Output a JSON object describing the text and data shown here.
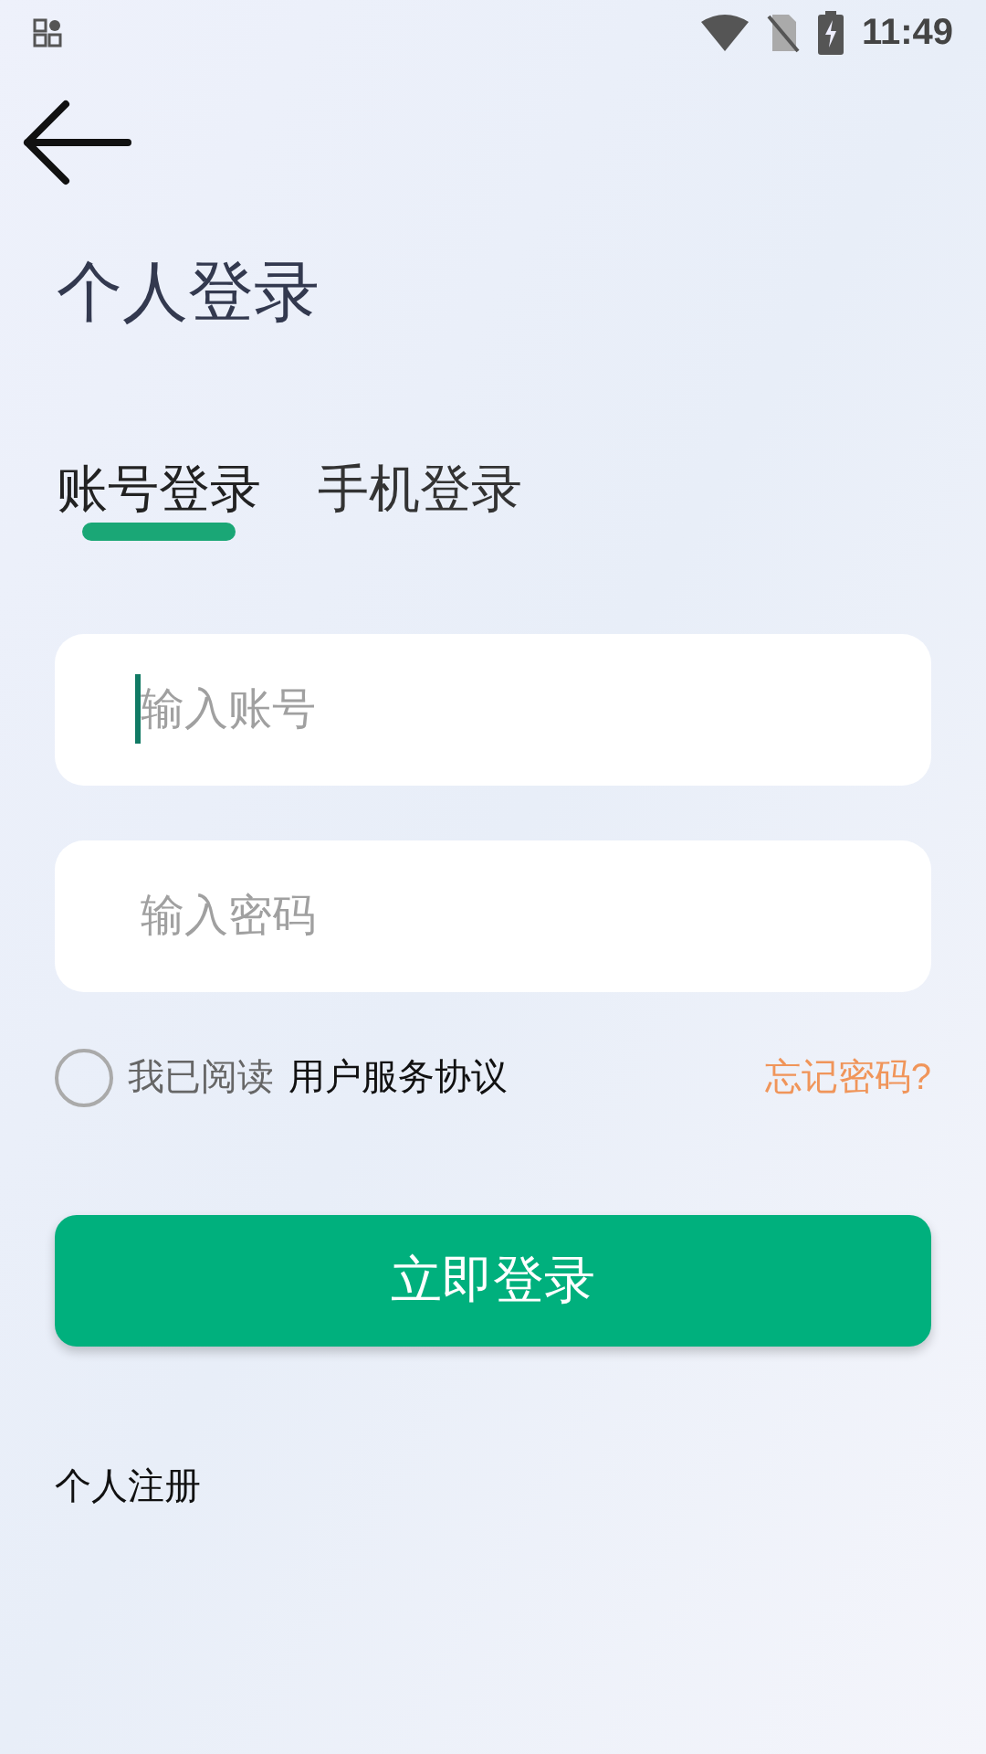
{
  "status_bar": {
    "time": "11:49"
  },
  "title": "个人登录",
  "tabs": [
    {
      "label": "账号登录",
      "selected": true
    },
    {
      "label": "手机登录",
      "selected": false
    }
  ],
  "fields": [
    {
      "placeholder": "输入账号",
      "focused": true
    },
    {
      "placeholder": "输入密码",
      "focused": false
    }
  ],
  "agreement": {
    "checked": false,
    "text": "我已阅读",
    "link": "用户服务协议"
  },
  "forgot_password": "忘记密码?",
  "login_button": "立即登录",
  "register_link": "个人注册"
}
